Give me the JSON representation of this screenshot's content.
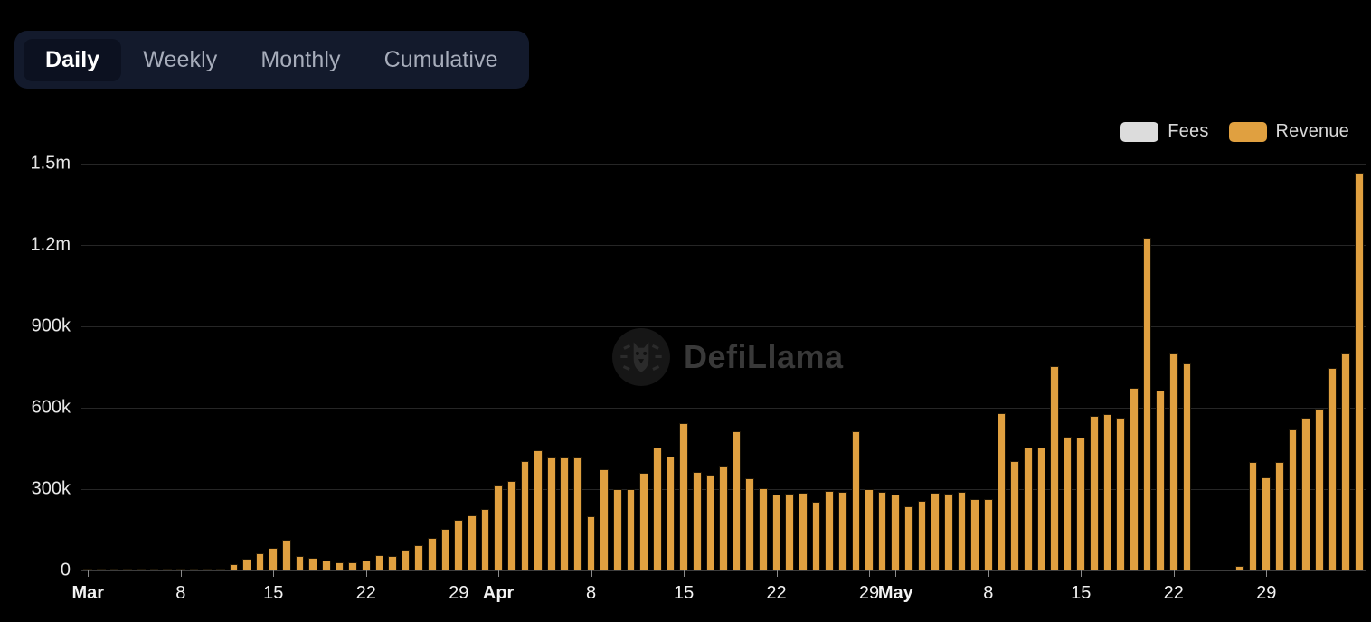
{
  "tabs": [
    {
      "label": "Daily",
      "active": true
    },
    {
      "label": "Weekly",
      "active": false
    },
    {
      "label": "Monthly",
      "active": false
    },
    {
      "label": "Cumulative",
      "active": false
    }
  ],
  "watermark": {
    "text": "DefiLlama",
    "logo_icon": "llama-logo-icon"
  },
  "legend": [
    {
      "label": "Fees",
      "color": "#dcdcdc"
    },
    {
      "label": "Revenue",
      "color": "#e0a040"
    }
  ],
  "colors": {
    "background": "#000000",
    "revenue": "#e0a040",
    "fees": "#dcdcdc",
    "grid": "#262626",
    "tabbar_bg": "#131a2c",
    "tab_active_bg": "#0c1120"
  },
  "chart_data": {
    "type": "bar",
    "title": "",
    "xlabel": "",
    "ylabel": "",
    "grid": true,
    "legend_position": "top-right",
    "ylim": [
      0,
      1500000
    ],
    "y_ticks": [
      0,
      300000,
      600000,
      900000,
      1200000,
      1500000
    ],
    "y_tick_labels": [
      "0",
      "300k",
      "600k",
      "900k",
      "1.2m",
      "1.5m"
    ],
    "x_tick_labels": [
      "Mar",
      "8",
      "15",
      "22",
      "29",
      "Apr",
      "8",
      "15",
      "22",
      "29",
      "May",
      "8",
      "15",
      "22",
      "29"
    ],
    "x_tick_days": [
      0,
      7,
      14,
      21,
      28,
      31,
      38,
      45,
      52,
      59,
      61,
      68,
      75,
      82,
      89
    ],
    "series": [
      {
        "name": "Fees",
        "values": []
      },
      {
        "name": "Revenue",
        "categories": [
          "Mar 1",
          "Mar 2",
          "Mar 3",
          "Mar 4",
          "Mar 5",
          "Mar 6",
          "Mar 7",
          "Mar 8",
          "Mar 9",
          "Mar 10",
          "Mar 11",
          "Mar 12",
          "Mar 13",
          "Mar 14",
          "Mar 15",
          "Mar 16",
          "Mar 17",
          "Mar 18",
          "Mar 19",
          "Mar 20",
          "Mar 21",
          "Mar 22",
          "Mar 23",
          "Mar 24",
          "Mar 25",
          "Mar 26",
          "Mar 27",
          "Mar 28",
          "Mar 29",
          "Mar 30",
          "Mar 31",
          "Apr 1",
          "Apr 2",
          "Apr 3",
          "Apr 4",
          "Apr 5",
          "Apr 6",
          "Apr 7",
          "Apr 8",
          "Apr 9",
          "Apr 10",
          "Apr 11",
          "Apr 12",
          "Apr 13",
          "Apr 14",
          "Apr 15",
          "Apr 16",
          "Apr 17",
          "Apr 18",
          "Apr 19",
          "Apr 20",
          "Apr 21",
          "Apr 22",
          "Apr 23",
          "Apr 24",
          "Apr 25",
          "Apr 26",
          "Apr 27",
          "Apr 28",
          "Apr 29",
          "Apr 30",
          "May 1",
          "May 2",
          "May 3",
          "May 4",
          "May 5",
          "May 6",
          "May 7",
          "May 8",
          "May 9",
          "May 10",
          "May 11",
          "May 12",
          "May 13",
          "May 14",
          "May 15",
          "May 16",
          "May 17",
          "May 18",
          "May 19",
          "May 20",
          "May 21",
          "May 22",
          "May 23",
          "May 24",
          "May 25",
          "May 26",
          "May 27",
          "May 28",
          "May 29",
          "May 30"
        ],
        "values": [
          4000,
          1500,
          1500,
          1500,
          1500,
          1500,
          1500,
          3000,
          2000,
          2000,
          4000,
          22000,
          45000,
          62000,
          85000,
          115000,
          52000,
          48000,
          38000,
          30000,
          30000,
          38000,
          58000,
          52000,
          78000,
          92000,
          120000,
          155000,
          188000,
          205000,
          228000,
          315000,
          330000,
          405000,
          442000,
          418000,
          418000,
          418000,
          200000,
          372000,
          300000,
          300000,
          360000,
          455000,
          420000,
          545000,
          362000,
          352000,
          385000,
          512000,
          340000,
          305000,
          280000,
          285000,
          288000,
          252000,
          295000,
          290000,
          515000,
          300000,
          290000,
          280000,
          238000,
          258000,
          288000,
          282000,
          290000,
          262000,
          262000,
          580000,
          405000,
          452000,
          455000,
          755000,
          492000,
          490000,
          570000,
          578000,
          565000,
          672000,
          1228000,
          662000,
          800000,
          762000,
          0,
          0,
          0,
          18000,
          400000,
          400000,
          345000
        ],
        "values_tail": [
          345000,
          400000,
          520000,
          562000,
          598000,
          748000,
          800000,
          1468000
        ]
      }
    ]
  }
}
